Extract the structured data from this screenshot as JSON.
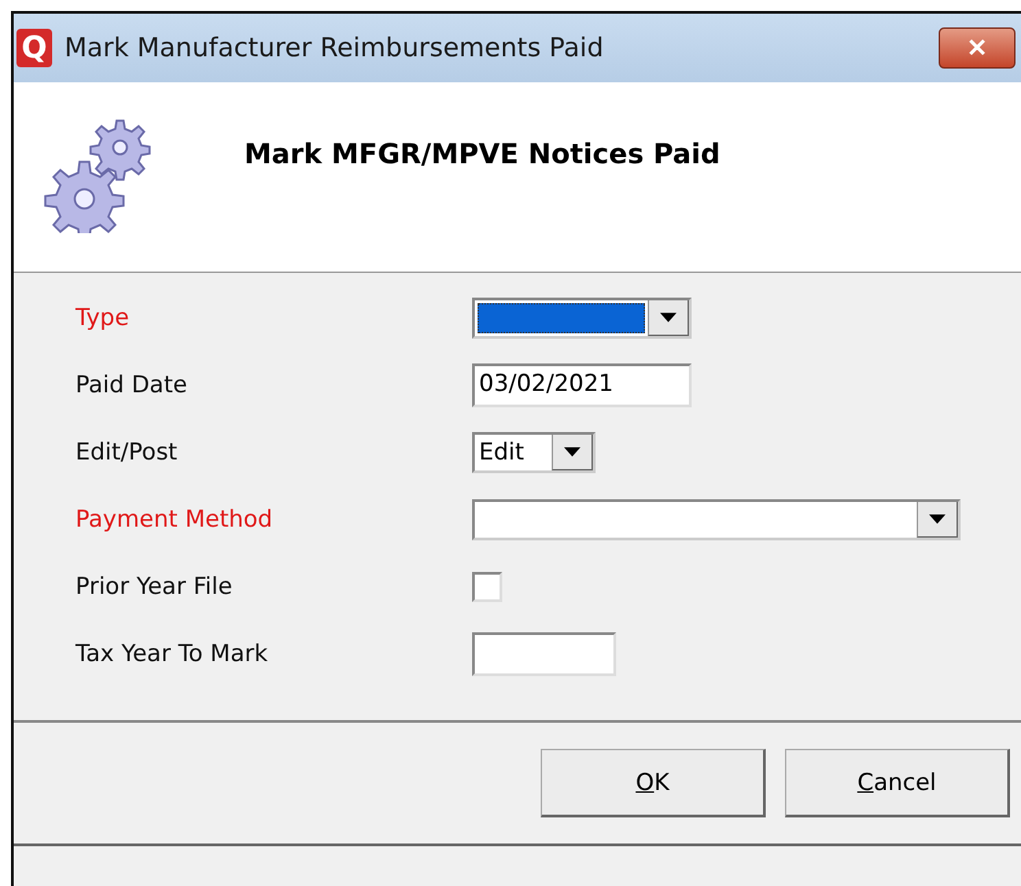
{
  "window": {
    "title": "Mark Manufacturer Reimbursements Paid",
    "app_icon": "Q",
    "close": "✕"
  },
  "header": {
    "title": "Mark MFGR/MPVE Notices Paid"
  },
  "fields": [
    {
      "label": "Type",
      "required": true,
      "kind": "combo",
      "highlighted": true
    },
    {
      "label": "Paid Date",
      "required": false,
      "kind": "text",
      "value": "03/02/2021"
    },
    {
      "label": "Edit/Post",
      "required": false,
      "kind": "combo",
      "value": "Edit",
      "highlighted": false
    },
    {
      "label": "Payment Method",
      "required": true,
      "kind": "combo",
      "highlighted": false
    },
    {
      "label": "Prior Year File",
      "required": false,
      "kind": "checkbox",
      "checked": false
    },
    {
      "label": "Tax Year To Mark",
      "required": false,
      "kind": "text"
    }
  ],
  "buttons": [
    {
      "mnemonic": "O",
      "rest": "K"
    },
    {
      "mnemonic": "C",
      "rest": "ancel"
    }
  ]
}
